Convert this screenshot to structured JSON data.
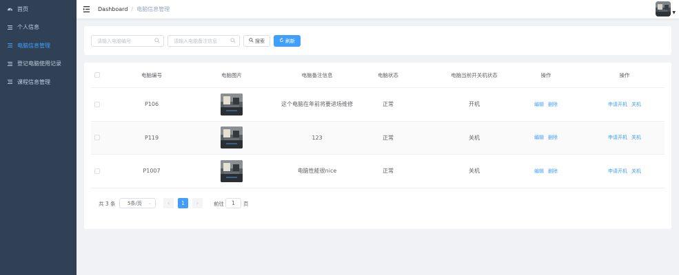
{
  "sidebar": {
    "items": [
      {
        "label": "首页",
        "icon": "dashboard-icon"
      },
      {
        "label": "个人信息",
        "icon": "list-icon"
      },
      {
        "label": "电脑信息管理",
        "icon": "list-icon",
        "active": true
      },
      {
        "label": "登记电脑使用记录",
        "icon": "list-icon"
      },
      {
        "label": "课程信息管理",
        "icon": "list-icon"
      }
    ]
  },
  "navbar": {
    "breadcrumb_root": "Dashboard",
    "breadcrumb_sep": "/",
    "breadcrumb_current": "电脑信息管理"
  },
  "search": {
    "number_placeholder": "请输入电脑编号",
    "remark_placeholder": "请输入电脑备注信息",
    "search_label": "搜索",
    "refresh_label": "刷新"
  },
  "table": {
    "headers": [
      "电脑编号",
      "电脑图片",
      "电脑备注信息",
      "电脑状态",
      "电脑当前开关机状态",
      "操作",
      "操作"
    ],
    "rows": [
      {
        "id": "P106",
        "remark": "这个电脑在年前将要进场维修",
        "status": "正常",
        "power": "开机"
      },
      {
        "id": "P119",
        "remark": "123",
        "status": "正常",
        "power": "关机"
      },
      {
        "id": "P1007",
        "remark": "电脑性能很nice",
        "status": "正常",
        "power": "关机"
      }
    ],
    "actions": {
      "edit": "编辑",
      "delete": "删除",
      "apply_on": "申请开机",
      "shutdown": "关机"
    }
  },
  "pagination": {
    "total": "共 3 条",
    "page_size": "5条/页",
    "current": "1",
    "goto_label": "前往",
    "goto_value": "1",
    "page_suffix": "页"
  },
  "colors": {
    "sidebar_bg": "#304156",
    "accent": "#409eff",
    "sidebar_text": "#bfcbd9"
  }
}
